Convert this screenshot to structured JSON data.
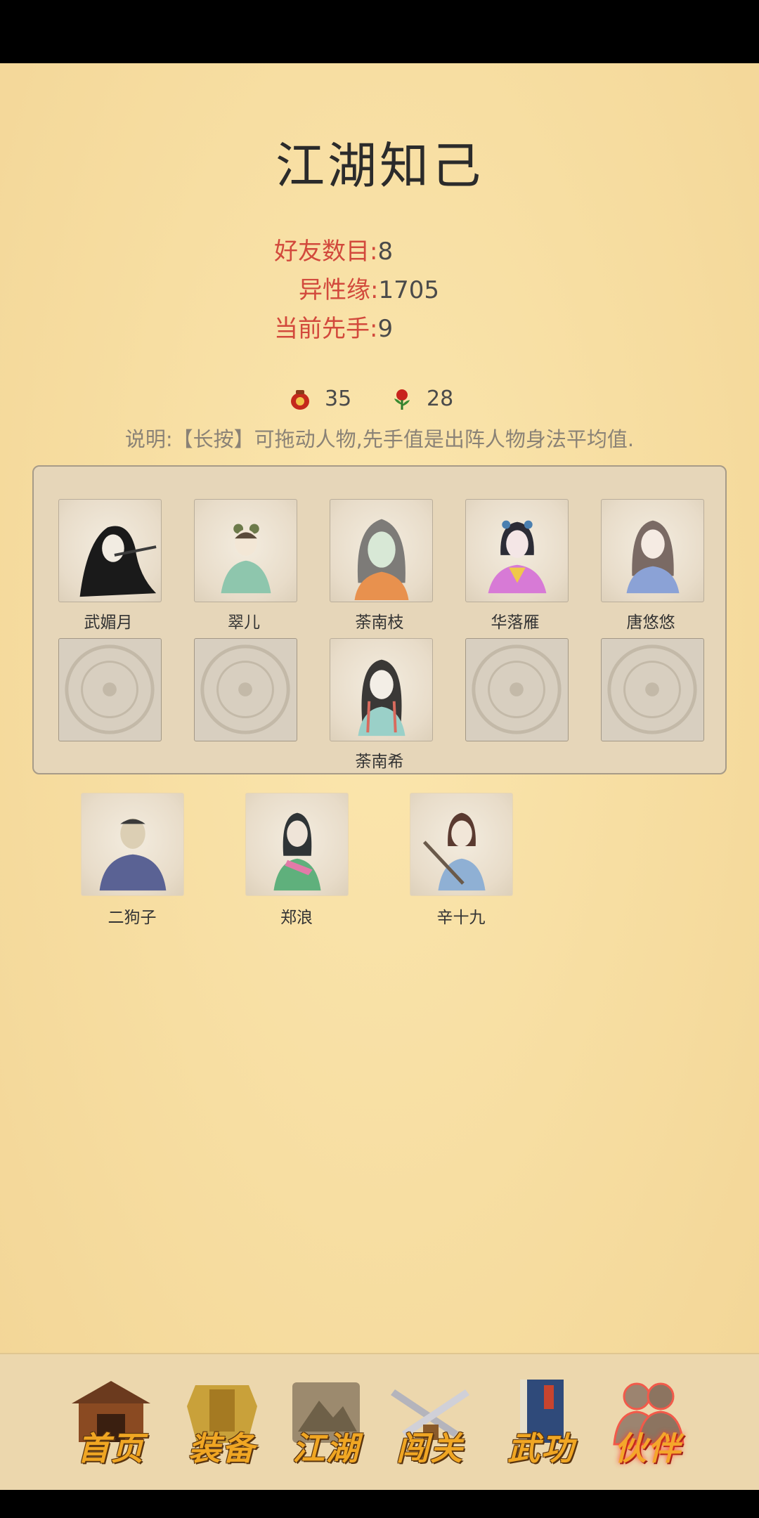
{
  "page": {
    "title": "江湖知己"
  },
  "stats": {
    "friends_label": "好友数目:",
    "friends_value": "8",
    "affinity_label": "异性缘:",
    "affinity_value": "1705",
    "initiative_label": "当前先手:",
    "initiative_value": "9"
  },
  "resources": {
    "wine_count": "35",
    "rose_count": "28"
  },
  "note": "说明:【长按】可拖动人物,先手值是出阵人物身法平均值.",
  "team": {
    "row1": [
      "武媚月",
      "翠儿",
      "荼南枝",
      "华落雁",
      "唐悠悠"
    ],
    "row2": [
      "",
      "",
      "荼南希",
      "",
      ""
    ]
  },
  "bench": [
    "二狗子",
    "郑浪",
    "辛十九"
  ],
  "nav": {
    "items": [
      {
        "label": "首页",
        "icon": "gate-icon"
      },
      {
        "label": "装备",
        "icon": "armor-icon"
      },
      {
        "label": "江湖",
        "icon": "scroll-icon"
      },
      {
        "label": "闯关",
        "icon": "swords-icon"
      },
      {
        "label": "武功",
        "icon": "book-icon"
      },
      {
        "label": "伙伴",
        "icon": "partners-icon"
      }
    ],
    "active": "伙伴"
  },
  "colors": {
    "accent_red": "#d2493c",
    "background": "#f7dea2",
    "panel": "#e6d6b9",
    "nav_label": "#f0a623"
  }
}
